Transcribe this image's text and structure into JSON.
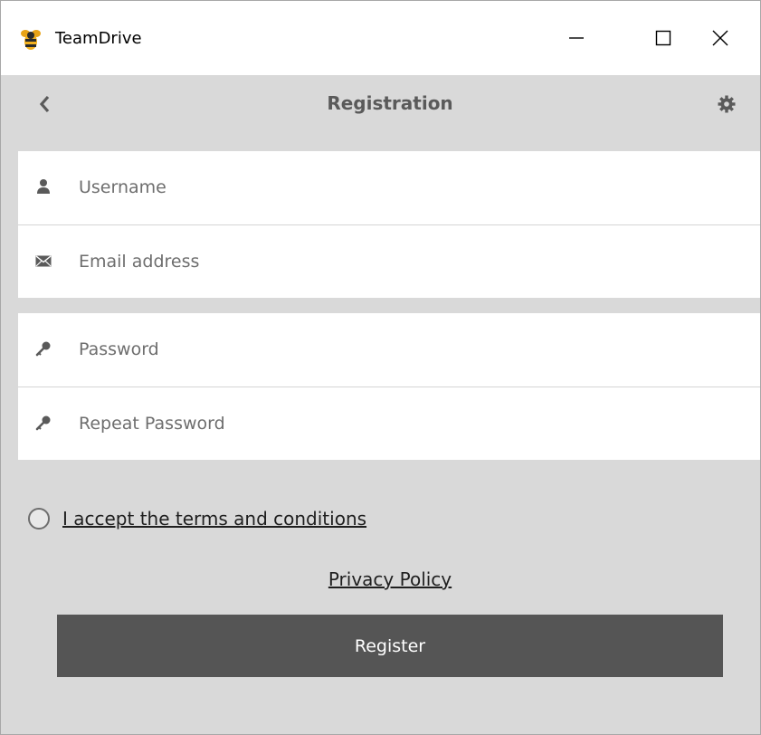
{
  "window": {
    "title": "TeamDrive"
  },
  "header": {
    "title": "Registration"
  },
  "fields": {
    "username": {
      "placeholder": "Username",
      "value": ""
    },
    "email": {
      "placeholder": "Email address",
      "value": ""
    },
    "password": {
      "placeholder": "Password",
      "value": ""
    },
    "repeat_password": {
      "placeholder": "Repeat Password",
      "value": ""
    }
  },
  "terms": {
    "label": "I accept the terms and conditions",
    "checked": false
  },
  "privacy_link": "Privacy Policy",
  "register_button": "Register",
  "icons": {
    "app": "teamdrive-bee-icon",
    "back": "chevron-left-icon",
    "settings": "gear-icon",
    "username": "user-icon",
    "email": "envelope-icon",
    "password": "key-icon",
    "repeat_password": "key-icon"
  },
  "colors": {
    "background": "#d9d9d9",
    "button": "#555555",
    "header_text": "#5a5a5a"
  }
}
